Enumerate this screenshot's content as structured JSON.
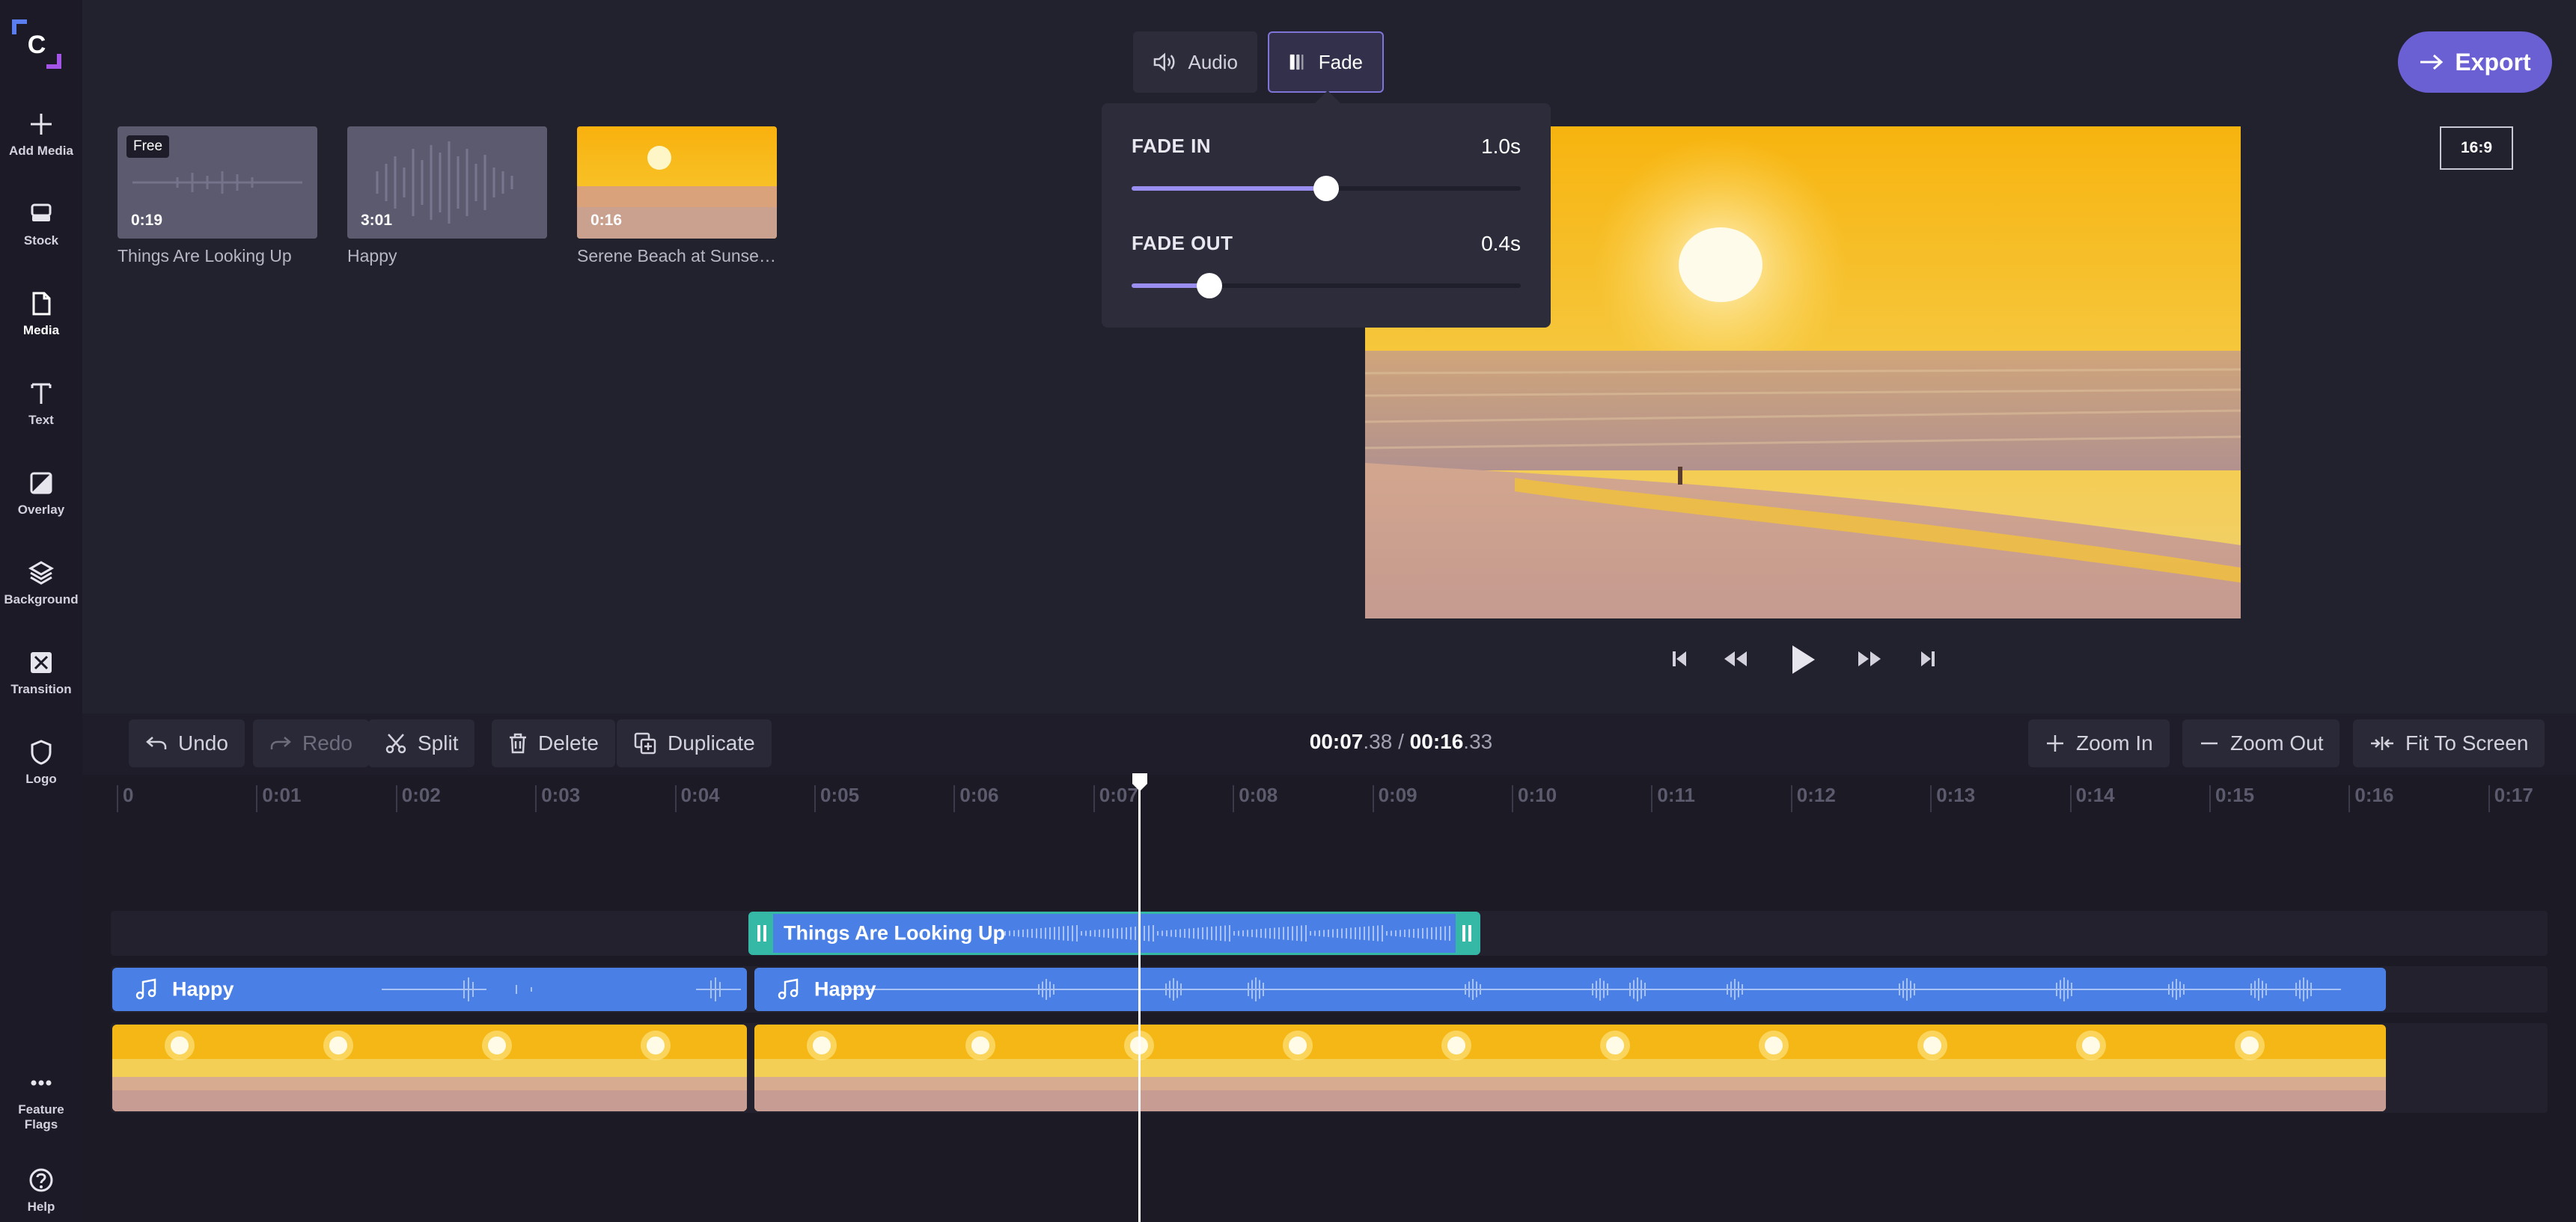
{
  "sidebar": {
    "items": [
      {
        "label": "Add Media",
        "icon": "plus-icon"
      },
      {
        "label": "Stock",
        "icon": "stock-icon"
      },
      {
        "label": "Media",
        "icon": "file-icon"
      },
      {
        "label": "Text",
        "icon": "text-icon"
      },
      {
        "label": "Overlay",
        "icon": "overlay-icon"
      },
      {
        "label": "Background",
        "icon": "layers-icon"
      },
      {
        "label": "Transition",
        "icon": "transition-icon"
      },
      {
        "label": "Logo",
        "icon": "shield-icon"
      }
    ],
    "active_item": "Media",
    "bottom": [
      {
        "label": "Feature Flags",
        "icon": "more-icon"
      },
      {
        "label": "Help",
        "icon": "help-icon"
      }
    ]
  },
  "tabs": {
    "audio_label": "Audio",
    "fade_label": "Fade",
    "active": "Fade"
  },
  "export_label": "Export",
  "aspect_ratio": "16:9",
  "media": [
    {
      "title": "Things Are Looking Up",
      "duration": "0:19",
      "badge": "Free",
      "kind": "audio"
    },
    {
      "title": "Happy",
      "duration": "3:01",
      "kind": "audio"
    },
    {
      "title": "Serene Beach at Sunset ...",
      "duration": "0:16",
      "kind": "video"
    }
  ],
  "fade": {
    "fade_in": {
      "label": "FADE IN",
      "value_text": "1.0s",
      "fraction": 0.5
    },
    "fade_out": {
      "label": "FADE OUT",
      "value_text": "0.4s",
      "fraction": 0.2
    }
  },
  "toolbar": {
    "undo": "Undo",
    "redo": "Redo",
    "split": "Split",
    "delete": "Delete",
    "duplicate": "Duplicate",
    "zoom_in": "Zoom In",
    "zoom_out": "Zoom Out",
    "fit": "Fit To Screen"
  },
  "time": {
    "current_main": "00:07",
    "current_frac": ".38",
    "separator": " / ",
    "total_main": "00:16",
    "total_frac": ".33"
  },
  "ruler": [
    "0",
    "0:01",
    "0:02",
    "0:03",
    "0:04",
    "0:05",
    "0:06",
    "0:07",
    "0:08",
    "0:09",
    "0:10",
    "0:11",
    "0:12",
    "0:13",
    "0:14",
    "0:15",
    "0:16",
    "0:17"
  ],
  "tracks": {
    "music_clip": "Things Are Looking Up",
    "audio_clip_1": "Happy",
    "audio_clip_2": "Happy"
  },
  "colors": {
    "accent": "#6a5fd3",
    "audio_clip": "#4a80e6",
    "music_clip": "#4a80e6",
    "music_clip_border": "#35b9a6"
  }
}
